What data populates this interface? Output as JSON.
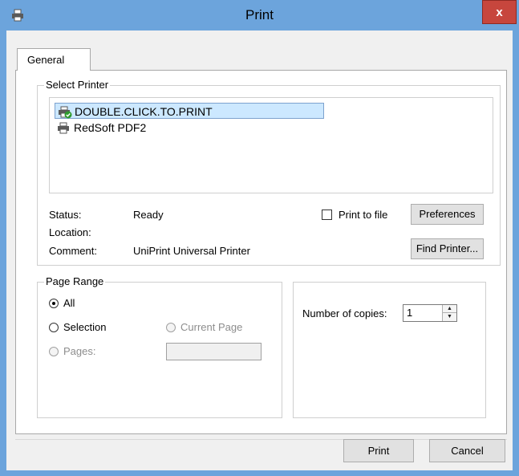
{
  "window": {
    "title": "Print",
    "close_label": "x"
  },
  "tabs": [
    {
      "label": "General"
    }
  ],
  "select_printer": {
    "legend": "Select Printer",
    "printers": [
      {
        "name": "DOUBLE.CLICK.TO.PRINT",
        "selected": true,
        "icon": "printer-default-check-icon"
      },
      {
        "name": "RedSoft PDF2",
        "selected": false,
        "icon": "printer-icon"
      }
    ],
    "status_label": "Status:",
    "status_value": "Ready",
    "location_label": "Location:",
    "location_value": "",
    "comment_label": "Comment:",
    "comment_value": "UniPrint Universal Printer",
    "print_to_file_label": "Print to file",
    "print_to_file_checked": false,
    "preferences_label": "Preferences",
    "find_printer_label": "Find Printer..."
  },
  "page_range": {
    "legend": "Page Range",
    "all_label": "All",
    "selection_label": "Selection",
    "current_page_label": "Current Page",
    "pages_label": "Pages:",
    "selected_option": "All",
    "pages_value": ""
  },
  "copies": {
    "label": "Number of copies:",
    "value": "1"
  },
  "footer": {
    "print_label": "Print",
    "cancel_label": "Cancel"
  },
  "colors": {
    "titlebar": "#6ca4dc",
    "close_button": "#c7463d",
    "selection_highlight": "#cce8ff"
  }
}
